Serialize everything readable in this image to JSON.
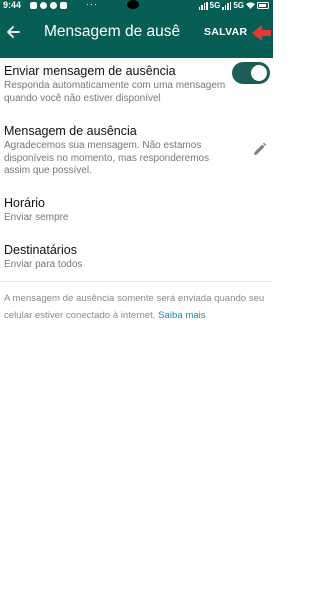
{
  "status_bar": {
    "time": "9:44",
    "dots": "···",
    "network_label_1": "5G",
    "network_label_2": "5G"
  },
  "app_bar": {
    "title": "Mensagem de ausê",
    "save_label": "SALVAR"
  },
  "settings": {
    "away_toggle": {
      "title": "Enviar mensagem de ausência",
      "subtitle": "Responda automaticamente com uma mensagem quando você não estiver disponível",
      "enabled": true
    },
    "away_message": {
      "title": "Mensagem de ausência",
      "subtitle": "Agradecemos sua mensagem. Não estamos disponíveis no momento, mas responderemos assim que possível."
    },
    "schedule": {
      "title": "Horário",
      "subtitle": "Enviar sempre"
    },
    "recipients": {
      "title": "Destinatários",
      "subtitle": "Enviar para todos"
    }
  },
  "footer": {
    "note": "A mensagem de ausência somente será enviada quando seu celular estiver conectado à internet.",
    "link": "Saiba mais"
  },
  "colors": {
    "header": "#075e54",
    "toggle_on": "#1c5d57",
    "link": "#1a86b8",
    "annotation_arrow": "#e53935"
  }
}
